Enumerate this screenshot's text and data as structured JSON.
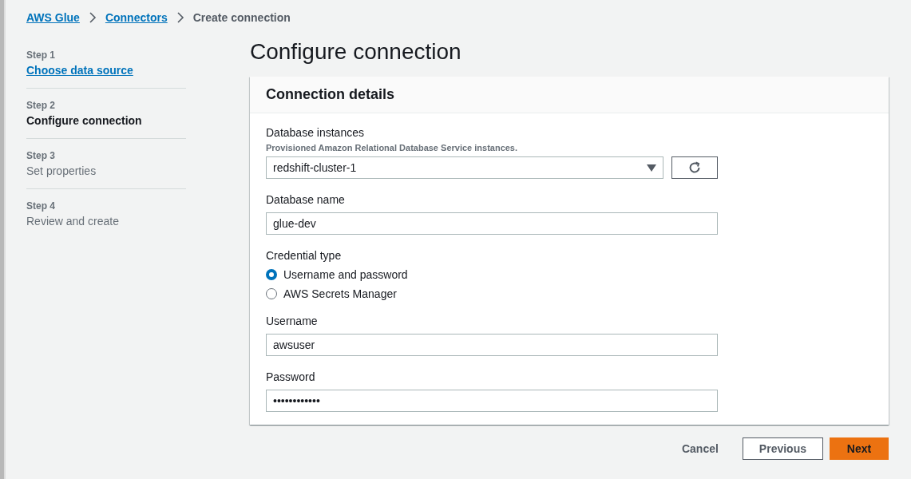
{
  "breadcrumbs": [
    {
      "label": "AWS Glue",
      "link": true
    },
    {
      "label": "Connectors",
      "link": true
    },
    {
      "label": "Create connection",
      "link": false
    }
  ],
  "steps": [
    {
      "step": "Step 1",
      "title": "Choose data source",
      "kind": "link"
    },
    {
      "step": "Step 2",
      "title": "Configure connection",
      "kind": "current"
    },
    {
      "step": "Step 3",
      "title": "Set properties",
      "kind": "upcoming"
    },
    {
      "step": "Step 4",
      "title": "Review and create",
      "kind": "upcoming"
    }
  ],
  "page_title": "Configure connection",
  "card": {
    "title": "Connection details",
    "fields": [
      {
        "kind": "select",
        "label": "Database instances",
        "description": "Provisioned Amazon Relational Database Service instances.",
        "value": "redshift-cluster-1"
      },
      {
        "kind": "text",
        "label": "Database name",
        "value": "glue-dev"
      },
      {
        "kind": "radio",
        "label": "Credential type",
        "options": [
          {
            "label": "Username and password",
            "selected": true
          },
          {
            "label": "AWS Secrets Manager",
            "selected": false
          }
        ]
      },
      {
        "kind": "text",
        "label": "Username",
        "value": "awsuser"
      },
      {
        "kind": "text",
        "label": "Password",
        "value": "••••••••••••"
      }
    ]
  },
  "actions": [
    {
      "label": "Cancel",
      "kind": "link"
    },
    {
      "label": "Previous",
      "kind": "normal"
    },
    {
      "label": "Next",
      "kind": "primary"
    }
  ]
}
